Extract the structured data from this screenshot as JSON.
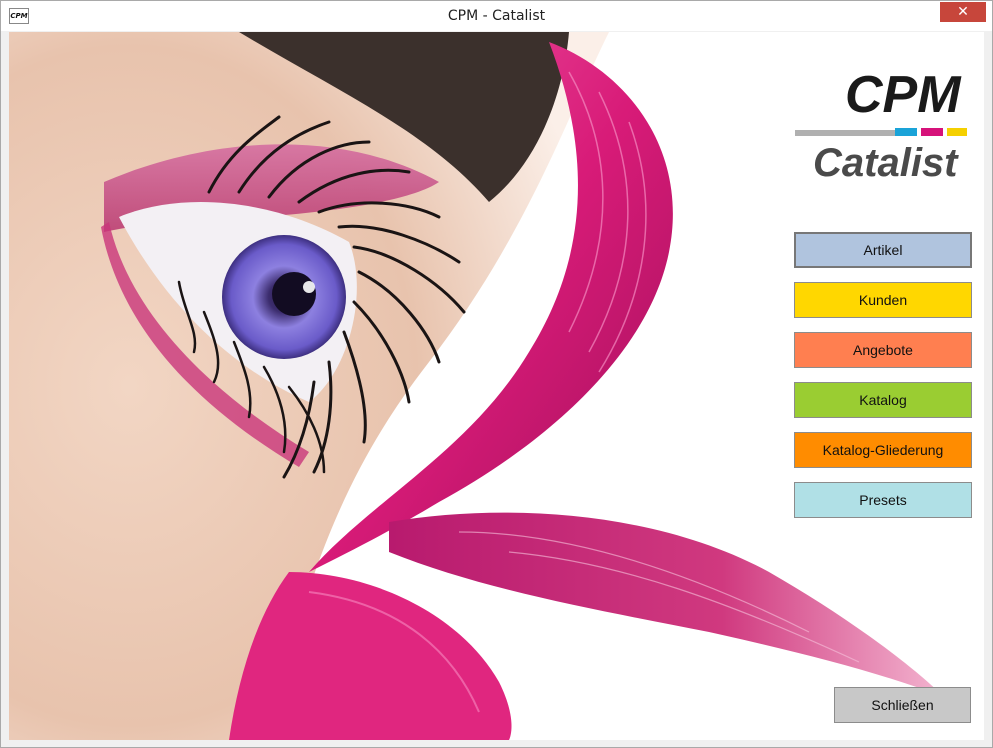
{
  "window": {
    "title": "CPM - Catalist",
    "app_icon_text": "CPM",
    "close_symbol": "✕"
  },
  "logo": {
    "brand": "CPM",
    "product": "Catalist"
  },
  "menu": {
    "buttons": [
      {
        "label": "Artikel",
        "color": "#b0c4de"
      },
      {
        "label": "Kunden",
        "color": "#ffd700"
      },
      {
        "label": "Angebote",
        "color": "#ff7f50"
      },
      {
        "label": "Katalog",
        "color": "#9acd32"
      },
      {
        "label": "Katalog-Gliederung",
        "color": "#ff8c00"
      },
      {
        "label": "Presets",
        "color": "#b0e0e6"
      }
    ]
  },
  "footer": {
    "close_label": "Schließen"
  },
  "colors": {
    "titlebar_close": "#c7463b",
    "feather": "#d81b78",
    "iris": "#7b6fd6",
    "logo_cyan": "#1aa3d8",
    "logo_magenta": "#d6127a",
    "logo_yellow": "#f5d000"
  }
}
